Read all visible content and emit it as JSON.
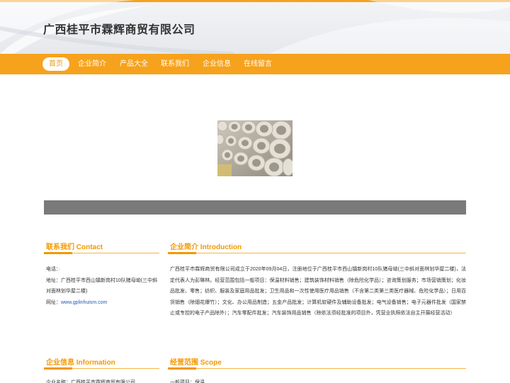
{
  "site": {
    "title": "广西桂平市霖辉商贸有限公司"
  },
  "nav": {
    "items": [
      "首页",
      "企业简介",
      "产品大全",
      "联系我们",
      "企业信息",
      "在线留言"
    ]
  },
  "sections": {
    "contact": {
      "title": "联系我们 Contact",
      "phone": "电话：·",
      "address": "地址：广西桂平市西山镇新岗村10队猪母坳(三中斜对面林划华屋二楼)",
      "website_label": "网址：",
      "website": "www.gplinhuism.com"
    },
    "intro": {
      "title": "企业简介 Introduction",
      "text": "广西桂平市霖辉商贸有限公司成立于2020年09月04日，注册地位于广西桂平市西山镇新岗村10队猪母坳(三中斜对面林划华屋二楼)，法定代表人为彭琳林。经营范围包括一般项目：保温材料销售；建筑装饰材料销售（除危险化学品）；咨询策划服务；市场营销策划；化妆品批发、零售；纺织、服装及家庭用品批发；卫生用品和一次性使用医疗用品销售（不含第二类第三类医疗器械、危险化学品）；日用百货销售（除烟花爆竹）；文化、办公用品制造；五金产品批发；计算机软硬件及辅助设备批发；电气设备销售；电子元器件批发（国家禁止或专控的电子产品除外）；汽车零配件批发；汽车装饰用品销售（除依法须经批准的项目外，凭营业执照依法自主开展经营活动）"
    },
    "info": {
      "title": "企业信息 Information",
      "cutoff": "企业名称：广西桂平市霖辉商贸有限公司"
    },
    "scope": {
      "title": "经营范围 Scope",
      "cutoff": "一般项目：保温"
    }
  },
  "colors": {
    "accent": "#f7a21c",
    "accent_text": "#f39800",
    "banner_gray": "#7a7a7a",
    "link": "#1d5bb5"
  }
}
